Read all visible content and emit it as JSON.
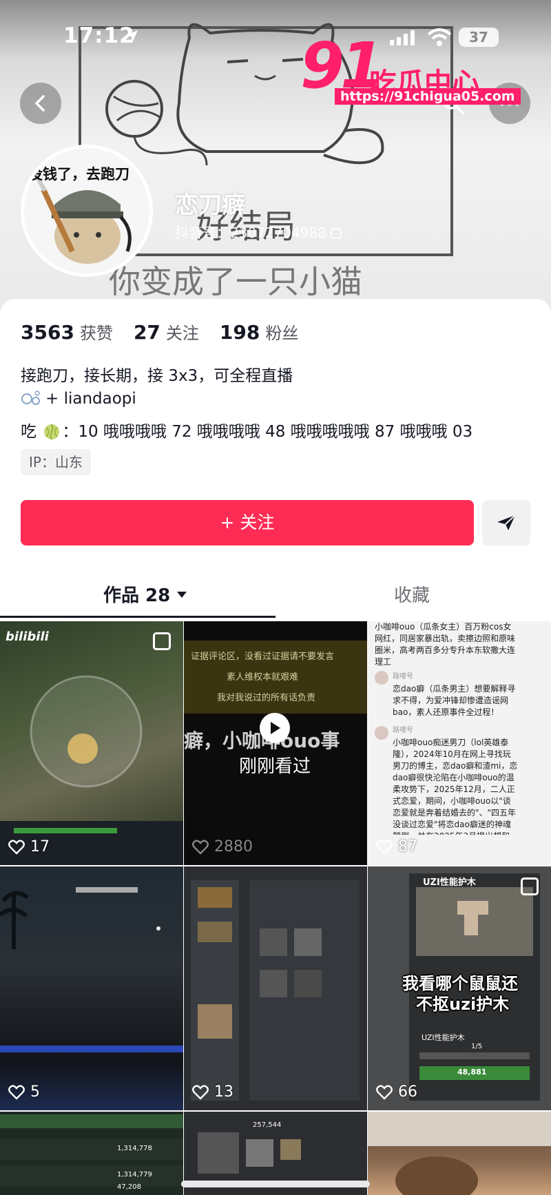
{
  "status_bar": {
    "time": "17:12",
    "battery": "37"
  },
  "watermark": {
    "number": "91",
    "title": "吃瓜中心",
    "url": "https://91chigua05.com"
  },
  "banner": {
    "text_line1": "好结局",
    "text_line2": "你变成了一只小猫"
  },
  "avatar": {
    "caption": "没钱了，去跑刀"
  },
  "profile": {
    "nickname": "恋刀癖",
    "douyin_id": "抖音号：23072704988",
    "stats": [
      {
        "num": "3563",
        "label": "获赞"
      },
      {
        "num": "27",
        "label": "关注"
      },
      {
        "num": "198",
        "label": "粉丝"
      }
    ],
    "bio_line1": "接跑刀，接长期，接 3x3，可全程直播",
    "bio_line2": "+ liandaopi",
    "bio_line3_prefix": "吃",
    "bio_line3": "：10 哦哦哦哦 72 哦哦哦哦 48 哦哦哦哦哦 87 哦哦哦 03",
    "ip": "IP：山东",
    "follow_label": "+ 关注"
  },
  "tabs": {
    "works": "作品 28",
    "favorites": "收藏"
  },
  "colors": {
    "accent": "#fe2c55",
    "watermark": "#ff1f6b"
  },
  "grid": {
    "items": [
      {
        "likes": "17",
        "badge": "bilibili",
        "kind": "game"
      },
      {
        "likes": "2880",
        "kind": "video",
        "top_text1": "证据评论区，没看过证据请不要发言",
        "top_text2": "素人维权本就艰难",
        "top_text3": "我对我说过的所有话负责",
        "mid_text": "癖，小咖啡ouo事",
        "watched": "刚刚看过"
      },
      {
        "likes": "87",
        "kind": "doc",
        "doc1": "小咖啡ouo（瓜条女主）百万粉cos女网红，同居家暴出轨，卖擦边照和原味圈米，高考两百多分专升本东软撒大连理工",
        "name1": "路嗖号",
        "doc2": "恋dao癖（瓜条男主）想要解释寻求不得，为爱冲锋却惨遭造谣网bao，素人还原事件全过程！",
        "name2": "路嗖号",
        "doc3": "小咖啡ouo痴迷男刀（lol英雄泰隆），2024年10月在网上寻找玩男刀的博主，恋dao癖和渣mi，恋dao癖很快沦陷在小咖啡ouo的温柔攻势下，2025年12月，二人正式恋爱，期间，小咖啡ouo以\"谈恋爱就是奔着结婚去的\"、\"四五年没谈过恋爱\"将恋dao癖迷的神魂颠倒，并在2025年3月提出想和恋dao癖同居。"
      },
      {
        "likes": "5",
        "kind": "dark"
      },
      {
        "likes": "13",
        "kind": "inventory"
      },
      {
        "likes": "66",
        "kind": "item",
        "item_title": "UZI性能护木",
        "caption1": "我看哪个鼠鼠还",
        "caption2": "不抠uzi护木",
        "price": "48,881",
        "label": "UZI性能护木",
        "qty": "1/5"
      },
      {
        "kind": "trade",
        "values": [
          "1,314,778",
          "1,314,779",
          "47,208"
        ]
      },
      {
        "kind": "inventory2",
        "value": "257,544"
      },
      {
        "kind": "photo"
      }
    ]
  }
}
